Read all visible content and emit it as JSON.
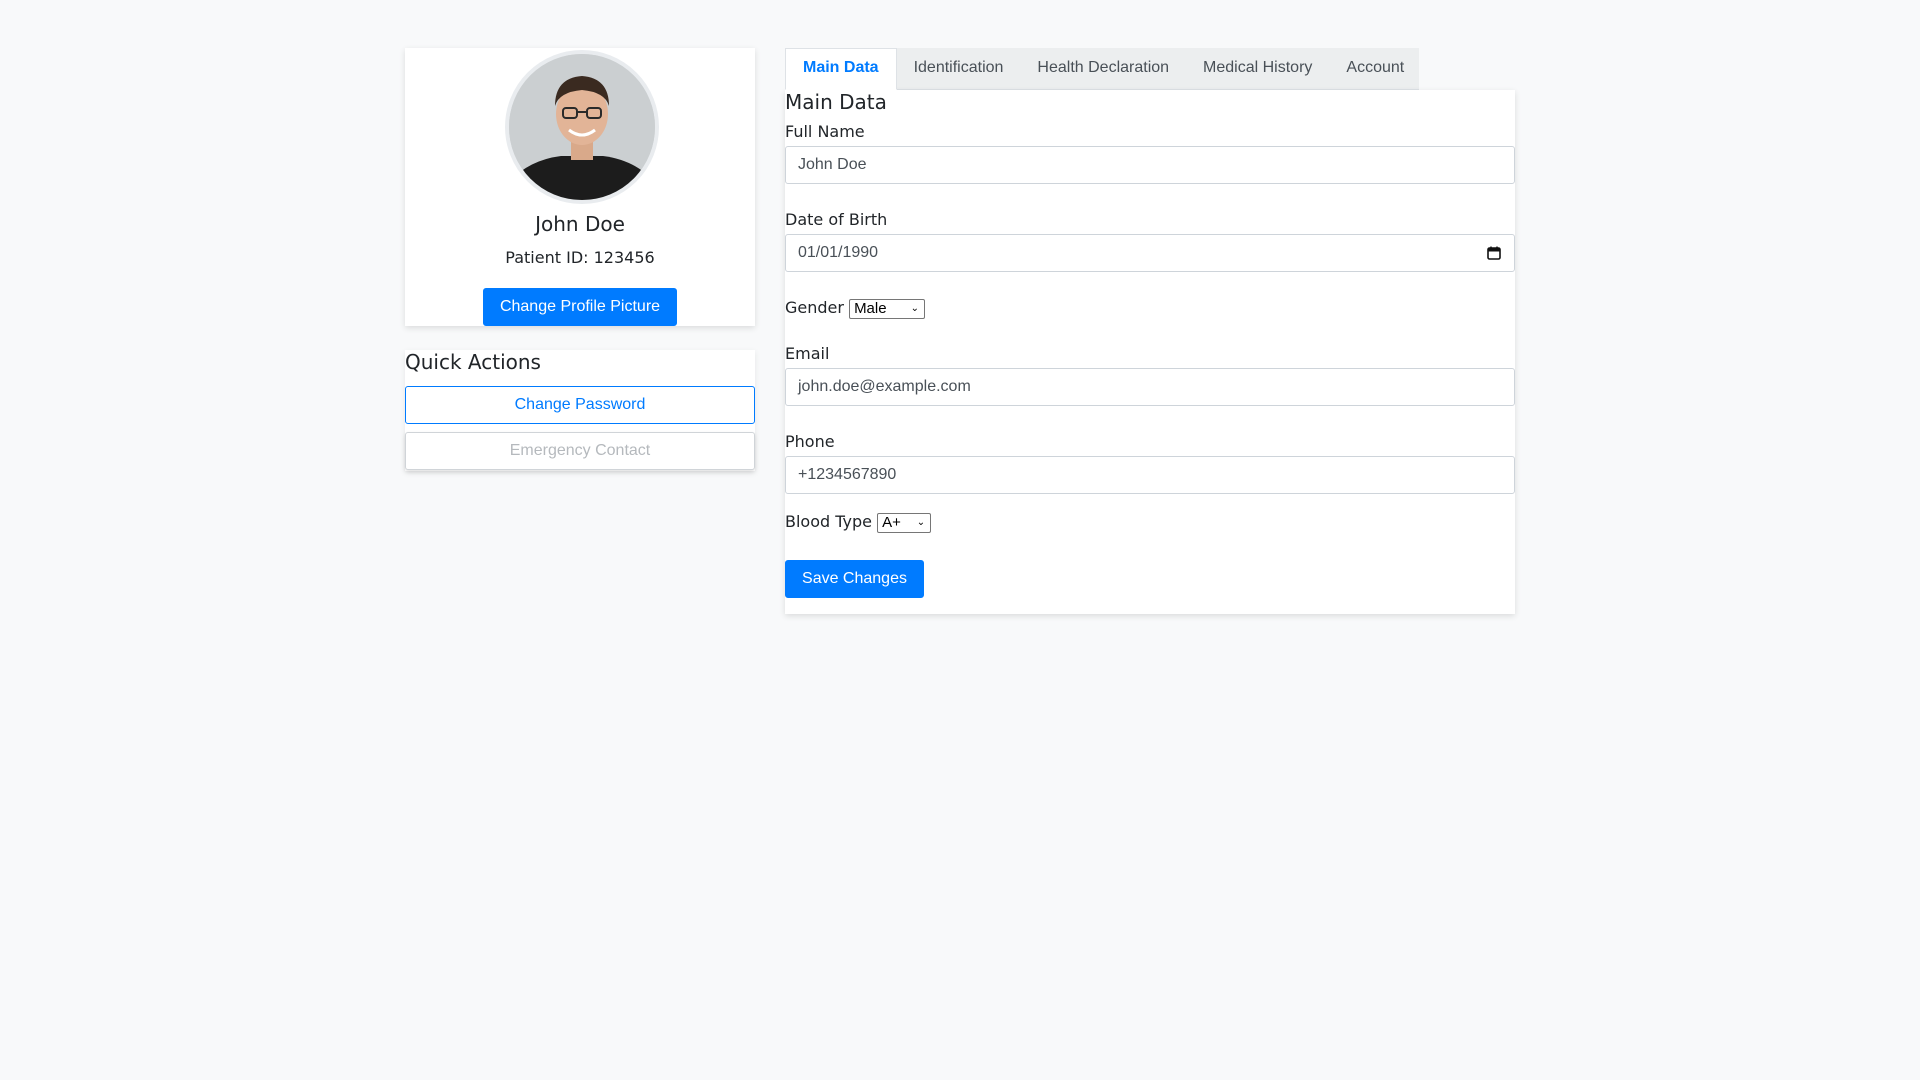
{
  "profile": {
    "name": "John Doe",
    "patient_id": "Patient ID: 123456",
    "change_picture_label": "Change Profile Picture"
  },
  "quick_actions": {
    "title": "Quick Actions",
    "change_password_label": "Change Password",
    "emergency_contact_label": "Emergency Contact"
  },
  "tabs": [
    {
      "label": "Main Data",
      "active": true
    },
    {
      "label": "Identification",
      "active": false
    },
    {
      "label": "Health Declaration",
      "active": false
    },
    {
      "label": "Medical History",
      "active": false
    },
    {
      "label": "Account",
      "active": false
    }
  ],
  "form": {
    "title": "Main Data",
    "full_name_label": "Full Name",
    "full_name_value": "John Doe",
    "dob_label": "Date of Birth",
    "dob_value": "01/01/1990",
    "gender_label": "Gender",
    "gender_value": "Male",
    "email_label": "Email",
    "email_value": "john.doe@example.com",
    "phone_label": "Phone",
    "phone_value": "+1234567890",
    "blood_type_label": "Blood Type",
    "blood_type_value": "A+",
    "save_label": "Save Changes"
  },
  "colors": {
    "accent": "#007bff",
    "background": "#f8f9fa"
  },
  "icons": {
    "calendar": "calendar-icon",
    "dropdown": "chevron-down-icon"
  }
}
